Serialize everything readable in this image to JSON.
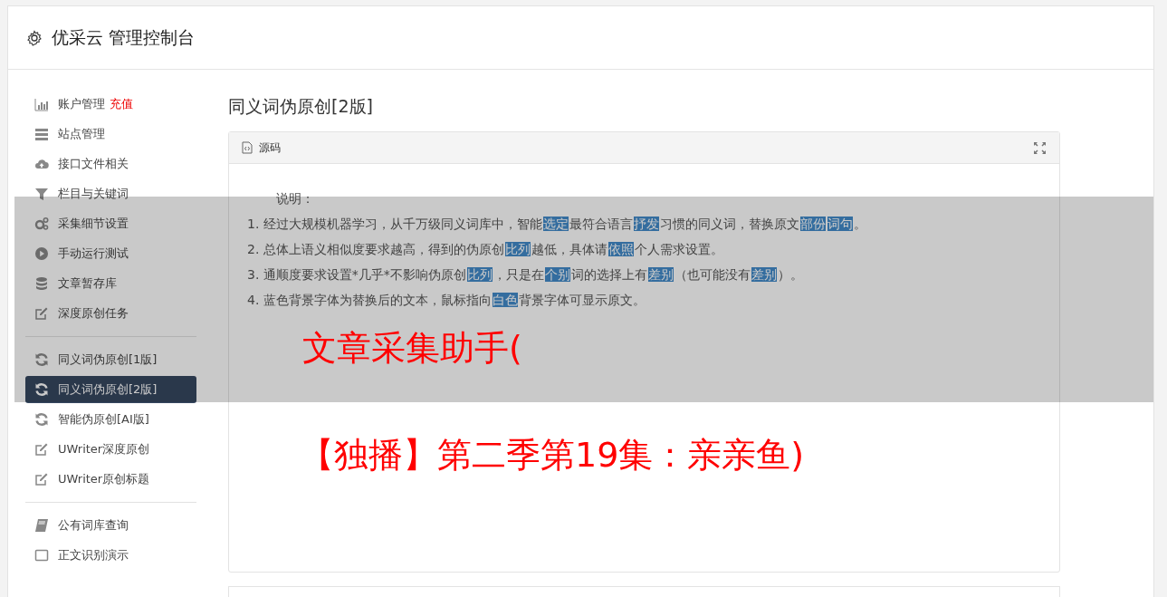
{
  "header": {
    "title": "优采云 管理控制台"
  },
  "sidebar": {
    "groups": [
      [
        {
          "label": "账户管理",
          "badge": "充值",
          "kind": "chart",
          "selected": false
        },
        {
          "label": "站点管理",
          "kind": "server",
          "selected": false
        },
        {
          "label": "接口文件相关",
          "kind": "cloud",
          "selected": false
        },
        {
          "label": "栏目与关键词",
          "kind": "filter",
          "selected": false
        },
        {
          "label": "采集细节设置",
          "kind": "gears",
          "selected": false
        },
        {
          "label": "手动运行测试",
          "kind": "play",
          "selected": false
        },
        {
          "label": "文章暂存库",
          "kind": "database",
          "selected": false
        },
        {
          "label": "深度原创任务",
          "kind": "edit",
          "selected": false
        }
      ],
      [
        {
          "label": "同义词伪原创[1版]",
          "kind": "refresh",
          "selected": false
        },
        {
          "label": "同义词伪原创[2版]",
          "kind": "refresh",
          "selected": true
        },
        {
          "label": "智能伪原创[AI版]",
          "kind": "refresh",
          "selected": false
        },
        {
          "label": "UWriter深度原创",
          "kind": "edit",
          "selected": false
        },
        {
          "label": "UWriter原创标题",
          "kind": "edit",
          "selected": false
        }
      ],
      [
        {
          "label": "公有词库查询",
          "kind": "book",
          "selected": false
        },
        {
          "label": "正文识别演示",
          "kind": "square",
          "selected": false
        }
      ]
    ]
  },
  "main": {
    "title": "同义词伪原创[2版]",
    "panel": {
      "title": "源码",
      "intro": "说明：",
      "lines": [
        [
          {
            "text": "1. 经过大规模机器学习，从千万级同义词库中，智能",
            "highlighted": false
          },
          {
            "text": "选定",
            "highlighted": true
          },
          {
            "text": "最符合语言",
            "highlighted": false
          },
          {
            "text": "抒发",
            "highlighted": true
          },
          {
            "text": "习惯的同义词，替换原文",
            "highlighted": false
          },
          {
            "text": "部份",
            "highlighted": true
          },
          {
            "text": "词句",
            "highlighted": true
          },
          {
            "text": "。",
            "highlighted": false
          }
        ],
        [
          {
            "text": "2. 总体上语义相似度要求越高，得到的伪原创",
            "highlighted": false
          },
          {
            "text": "比列",
            "highlighted": true
          },
          {
            "text": "越低，具体请",
            "highlighted": false
          },
          {
            "text": "依照",
            "highlighted": true
          },
          {
            "text": "个人需求设置。",
            "highlighted": false
          }
        ],
        [
          {
            "text": "3. 通顺度要求设置*几乎*不影响伪原创",
            "highlighted": false
          },
          {
            "text": "比列",
            "highlighted": true
          },
          {
            "text": "，只是在",
            "highlighted": false
          },
          {
            "text": "个别",
            "highlighted": true
          },
          {
            "text": "词的选择上有",
            "highlighted": false
          },
          {
            "text": "差别",
            "highlighted": true
          },
          {
            "text": "（也可能没有",
            "highlighted": false
          },
          {
            "text": "差别",
            "highlighted": true
          },
          {
            "text": "）。",
            "highlighted": false
          }
        ],
        [
          {
            "text": "4. 蓝色背景字体为替换后的文本，鼠标指向",
            "highlighted": false
          },
          {
            "text": "白色",
            "highlighted": true
          },
          {
            "text": "背景字体可显示原文。",
            "highlighted": false
          }
        ]
      ]
    }
  },
  "overlay": {
    "captions": [
      "文章采集助手(",
      "【独播】第二季第19集：亲亲鱼)"
    ]
  }
}
